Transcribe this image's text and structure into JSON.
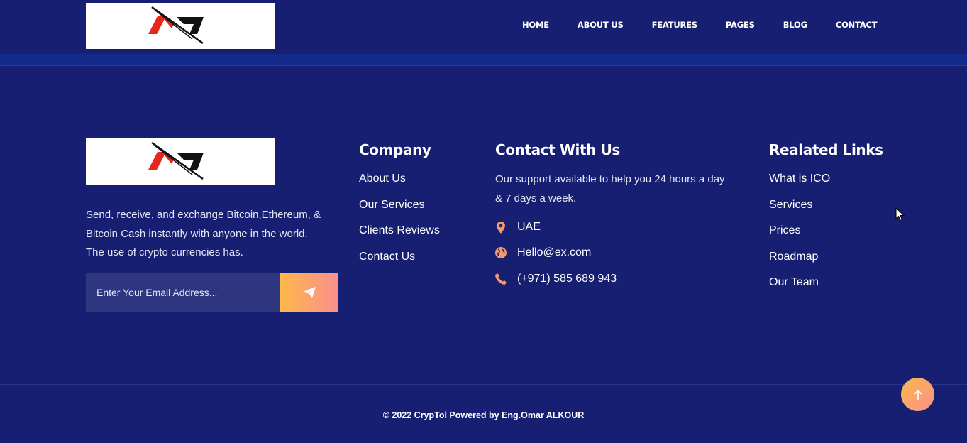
{
  "nav": {
    "items": [
      "HOME",
      "ABOUT US",
      "FEATURES",
      "PAGES",
      "BLOG",
      "CONTACT"
    ]
  },
  "about": {
    "text": "Send, receive, and exchange Bitcoin,Ethereum, & Bitcoin Cash instantly with anyone in the world. The use of crypto currencies has.",
    "email_placeholder": "Enter Your Email Address..."
  },
  "company": {
    "title": "Company",
    "links": [
      "About Us",
      "Our Services",
      "Clients Reviews",
      "Contact Us"
    ]
  },
  "contact": {
    "title": "Contact With Us",
    "description": "Our support available to help you 24 hours a day & 7 days a week.",
    "location": "UAE",
    "email": "Hello@ex.com",
    "phone": "(+971) 585 689 943"
  },
  "related": {
    "title": "Realated Links",
    "links": [
      "What is ICO",
      "Services",
      "Prices",
      "Roadmap",
      "Our Team"
    ]
  },
  "footer": {
    "copyright": "© 2022 CrypTol Powered by Eng.Omar ALKOUR"
  },
  "colors": {
    "background": "#161f72",
    "accent_start": "#fdb84a",
    "accent_end": "#fa8f8c",
    "icon": "#f59a6b"
  },
  "icons": {
    "location": "map-pin-icon",
    "email": "globe-icon",
    "phone": "phone-icon",
    "send": "paper-plane-icon",
    "scroll_top": "arrow-up-icon"
  }
}
